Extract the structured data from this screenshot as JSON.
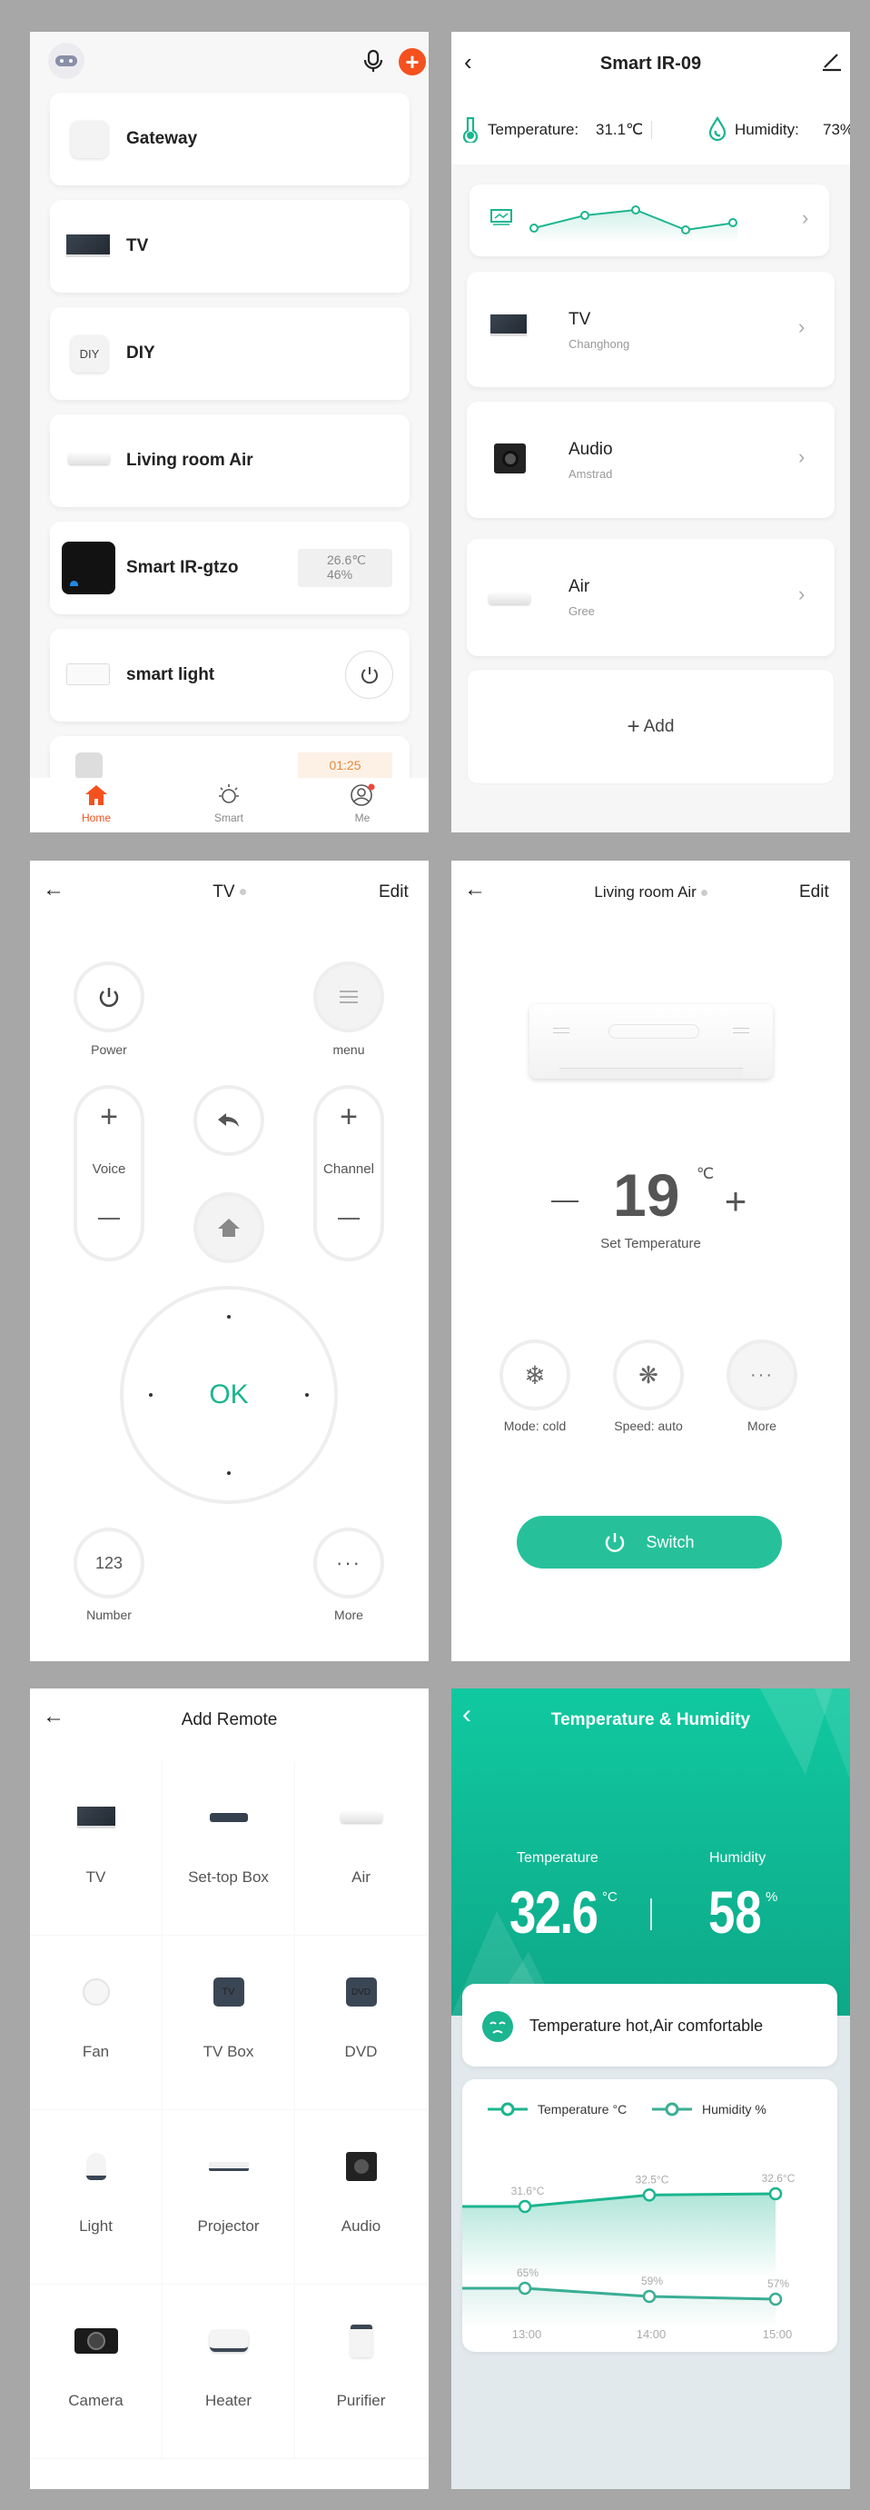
{
  "home": {
    "devices": [
      {
        "name": "Gateway",
        "icon": "gateway-icon"
      },
      {
        "name": "TV",
        "icon": "tv-icon"
      },
      {
        "name": "DIY",
        "icon": "diy-icon",
        "icon_text": "DIY"
      },
      {
        "name": "Living room Air",
        "icon": "air-conditioner-icon"
      },
      {
        "name": "Smart IR-gtzo",
        "icon": "smart-ir-icon",
        "temperature": "26.6℃",
        "humidity": "46%"
      },
      {
        "name": "smart light",
        "icon": "light-switch-icon"
      },
      {
        "name": "",
        "icon": "sensor-icon",
        "badge": "01:25"
      }
    ],
    "tabs": [
      {
        "label": "Home",
        "icon": "home-icon",
        "active": true
      },
      {
        "label": "Smart",
        "icon": "sun-icon"
      },
      {
        "label": "Me",
        "icon": "user-icon",
        "notification": true
      }
    ],
    "accent": "#f4511e"
  },
  "ir": {
    "title": "Smart IR-09",
    "temperature_label": "Temperature:",
    "temperature_value": "31.1℃",
    "humidity_label": "Humidity:",
    "humidity_value": "73%",
    "remotes": [
      {
        "name": "TV",
        "brand": "Changhong"
      },
      {
        "name": "Audio",
        "brand": "Amstrad"
      },
      {
        "name": "Air",
        "brand": "Gree"
      }
    ],
    "add_label": "Add"
  },
  "tv_remote": {
    "title": "TV",
    "edit": "Edit",
    "power": "Power",
    "menu": "menu",
    "voice": "Voice",
    "channel": "Channel",
    "ok": "OK",
    "number_button": "123",
    "number": "Number",
    "more": "More"
  },
  "air_remote": {
    "title": "Living room Air",
    "edit": "Edit",
    "set_temperature_value": "19",
    "unit": "℃",
    "set_temperature_label": "Set Temperature",
    "mode": "Mode: cold",
    "speed": "Speed: auto",
    "more": "More",
    "switch": "Switch",
    "accent": "#26c19a"
  },
  "add_remote": {
    "title": "Add Remote",
    "types": [
      {
        "name": "TV",
        "icon": "tv-icon"
      },
      {
        "name": "Set-top Box",
        "icon": "set-top-box-icon"
      },
      {
        "name": "Air",
        "icon": "air-conditioner-icon"
      },
      {
        "name": "Fan",
        "icon": "fan-icon"
      },
      {
        "name": "TV Box",
        "icon": "tv-box-icon",
        "icon_text": "TV"
      },
      {
        "name": "DVD",
        "icon": "dvd-icon",
        "icon_text": "DVD"
      },
      {
        "name": "Light",
        "icon": "light-bulb-icon"
      },
      {
        "name": "Projector",
        "icon": "projector-icon"
      },
      {
        "name": "Audio",
        "icon": "speaker-icon"
      },
      {
        "name": "Camera",
        "icon": "camera-icon"
      },
      {
        "name": "Heater",
        "icon": "heater-icon"
      },
      {
        "name": "Purifier",
        "icon": "purifier-icon"
      }
    ]
  },
  "temp_humidity": {
    "title": "Temperature & Humidity",
    "temperature_label": "Temperature",
    "temperature_value": "32.6",
    "temperature_unit": "°C",
    "humidity_label": "Humidity",
    "humidity_value": "58",
    "humidity_unit": "%",
    "status": "Temperature hot,Air comfortable",
    "accent": "#12c49a"
  },
  "chart_data": {
    "type": "line",
    "categories": [
      "13:00",
      "14:00",
      "15:00"
    ],
    "series": [
      {
        "name": "Temperature °C",
        "values": [
          31.6,
          32.5,
          32.6
        ],
        "labels": [
          "31.6°C",
          "32.5°C",
          "32.6°C"
        ],
        "color": "#1bb58f"
      },
      {
        "name": "Humidity %",
        "values": [
          65,
          59,
          57
        ],
        "labels": [
          "65%",
          "59%",
          "57%"
        ],
        "color": "#3aae95"
      }
    ],
    "grid": false,
    "legend": "top-left"
  }
}
